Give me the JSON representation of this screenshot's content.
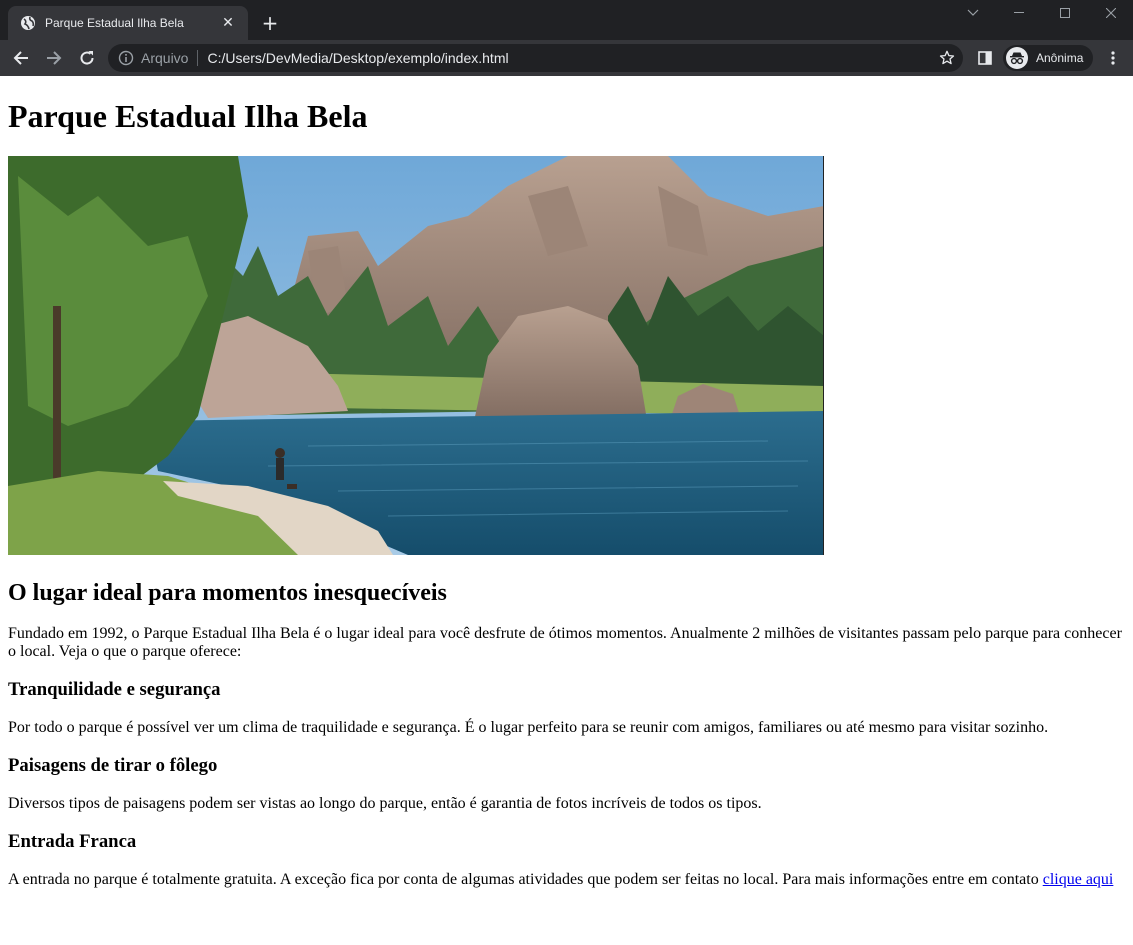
{
  "browser": {
    "tab": {
      "title": "Parque Estadual Ilha Bela",
      "favicon": "globe-icon"
    },
    "omnibox": {
      "scheme_label": "Arquivo",
      "url": "C:/Users/DevMedia/Desktop/exemplo/index.html"
    },
    "profile": {
      "label": "Anônima",
      "icon": "incognito-icon"
    },
    "colors": {
      "frame": "#202124",
      "toolbar": "#35363a",
      "text": "#e8eaed"
    }
  },
  "page": {
    "title": "Parque Estadual Ilha Bela",
    "subtitle": "O lugar ideal para momentos inesquecíveis",
    "intro": "Fundado em 1992, o Parque Estadual Ilha Bela é o lugar ideal para você desfrute de ótimos momentos. Anualmente 2 milhões de visitantes passam pelo parque para conhecer o local. Veja o que o parque oferece:",
    "sections": [
      {
        "heading": "Tranquilidade e segurança",
        "text": "Por todo o parque é possível ver um clima de traquilidade e segurança. É o lugar perfeito para se reunir com amigos, familiares ou até mesmo para visitar sozinho."
      },
      {
        "heading": "Paisagens de tirar o fôlego",
        "text": "Diversos tipos de paisagens podem ser vistas ao longo do parque, então é garantia de fotos incríveis de todos os tipos."
      },
      {
        "heading": "Entrada Franca",
        "text": "A entrada no parque é totalmente gratuita. A exceção fica por conta de algumas atividades que podem ser feitas no local. Para mais informações entre em contato ",
        "link": "clique aqui"
      }
    ]
  }
}
